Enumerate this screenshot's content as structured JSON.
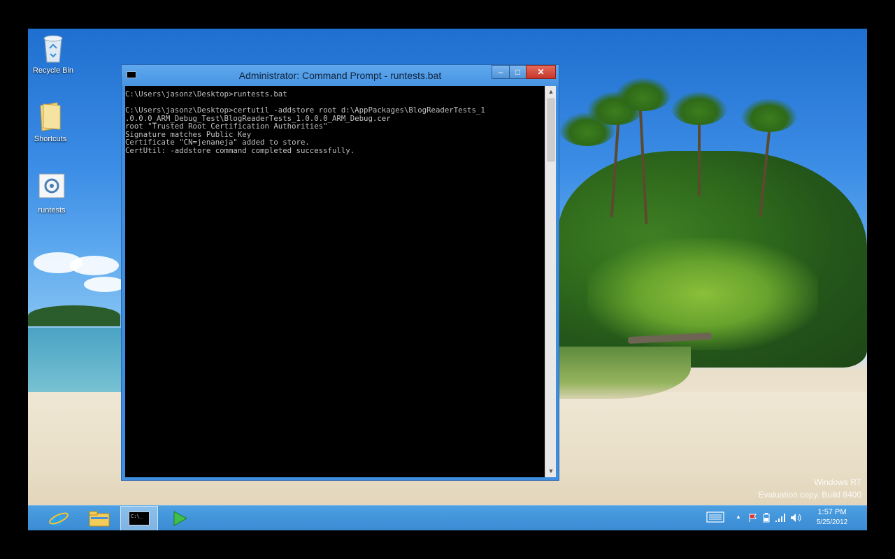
{
  "desktop": {
    "icons": [
      {
        "label": "Recycle Bin",
        "icon": "recycle-bin-icon"
      },
      {
        "label": "Shortcuts",
        "icon": "folder-icon"
      },
      {
        "label": "runtests",
        "icon": "batch-file-icon"
      }
    ],
    "watermark": {
      "line1": "Windows RT",
      "line2": "Evaluation copy. Build 8400"
    }
  },
  "cmd_window": {
    "title": "Administrator: Command Prompt - runtests.bat",
    "buttons": {
      "minimize": "–",
      "maximize": "□",
      "close": "✕"
    },
    "lines": [
      "C:\\Users\\jasonz\\Desktop>runtests.bat",
      "",
      "C:\\Users\\jasonz\\Desktop>certutil -addstore root d:\\AppPackages\\BlogReaderTests_1",
      ".0.0.0_ARM_Debug_Test\\BlogReaderTests_1.0.0.0_ARM_Debug.cer",
      "root \"Trusted Root Certification Authorities\"",
      "Signature matches Public Key",
      "Certificate \"CN=jenaneja\" added to store.",
      "CertUtil: -addstore command completed successfully."
    ],
    "scroll": {
      "up": "▲",
      "down": "▼"
    }
  },
  "taskbar": {
    "pinned": [
      {
        "name": "internet-explorer",
        "icon": "internet-explorer-icon",
        "active": false
      },
      {
        "name": "file-explorer",
        "icon": "file-explorer-icon",
        "active": false
      },
      {
        "name": "command-prompt",
        "icon": "command-prompt-icon",
        "active": true
      },
      {
        "name": "run-app",
        "icon": "play-icon",
        "active": false
      }
    ],
    "tray": {
      "keyboard": "keyboard-icon",
      "show_hidden": "▲",
      "clock_time": "1:57 PM",
      "clock_date": "5/25/2012"
    }
  },
  "colors": {
    "taskbar": "#3a8bd4",
    "window_frame": "#3d8ee0",
    "console_bg": "#000000",
    "console_text": "#c0c0c0",
    "close_button": "#c6372a"
  }
}
